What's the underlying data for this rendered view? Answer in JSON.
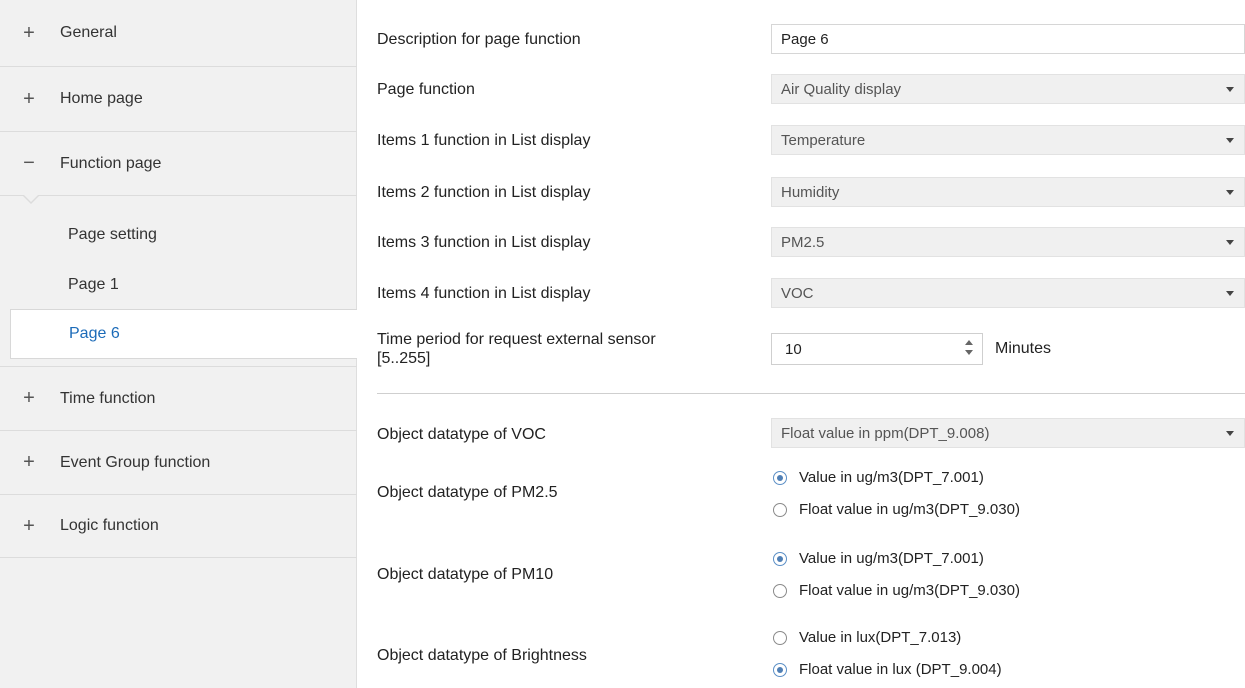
{
  "sidebar": {
    "items": [
      {
        "sign": "+",
        "label": "General"
      },
      {
        "sign": "+",
        "label": "Home page"
      },
      {
        "sign": "−",
        "label": "Function page"
      },
      {
        "sign": "+",
        "label": "Time function"
      },
      {
        "sign": "+",
        "label": "Event Group function"
      },
      {
        "sign": "+",
        "label": "Logic function"
      }
    ],
    "subitems": [
      "Page setting",
      "Page 1",
      "Page 6"
    ],
    "active_subitem": "Page 6"
  },
  "form": {
    "description": {
      "label": "Description for page function",
      "value": "Page 6"
    },
    "page_function": {
      "label": "Page function",
      "value": "Air Quality display"
    },
    "item1": {
      "label": "Items 1 function in List display",
      "value": "Temperature"
    },
    "item2": {
      "label": "Items 2 function in List display",
      "value": "Humidity"
    },
    "item3": {
      "label": "Items 3 function in List display",
      "value": "PM2.5"
    },
    "item4": {
      "label": "Items 4 function in List display",
      "value": "VOC"
    },
    "time_period": {
      "label_line1": "Time period for request external sensor",
      "label_line2": "[5..255]",
      "value": "10",
      "unit": "Minutes"
    },
    "voc_type": {
      "label": "Object datatype of VOC",
      "value": "Float value in ppm(DPT_9.008)"
    },
    "pm25_type": {
      "label": "Object datatype of PM2.5",
      "options": [
        "Value in ug/m3(DPT_7.001)",
        "Float value in ug/m3(DPT_9.030)"
      ],
      "selected": 0
    },
    "pm10_type": {
      "label": "Object datatype of PM10",
      "options": [
        "Value in ug/m3(DPT_7.001)",
        "Float value in ug/m3(DPT_9.030)"
      ],
      "selected": 0
    },
    "brightness_type": {
      "label": "Object datatype of Brightness",
      "options": [
        "Value in lux(DPT_7.013)",
        "Float value in lux (DPT_9.004)"
      ],
      "selected": 1
    }
  },
  "colors": {
    "active_link": "#1c6bb8",
    "sidebar_bg": "#f1f1f1",
    "radio_dot": "#4f7fb5"
  }
}
